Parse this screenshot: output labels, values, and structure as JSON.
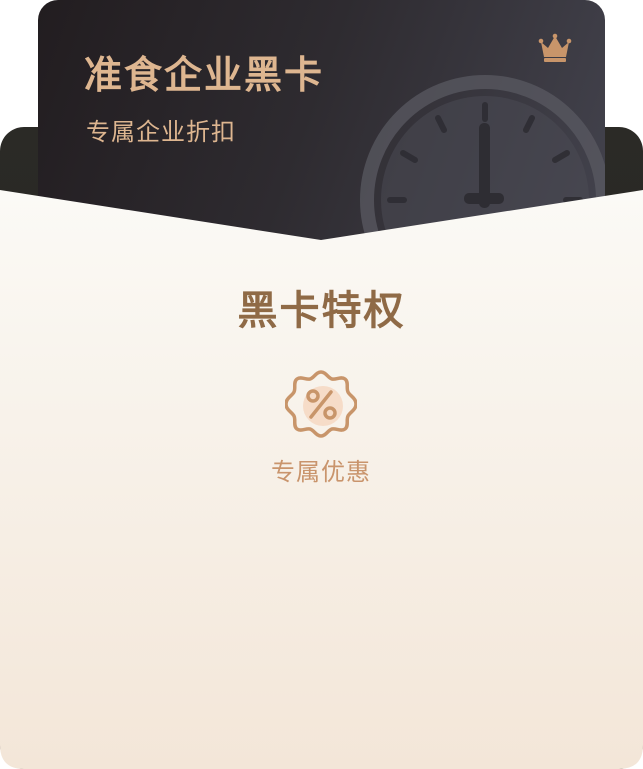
{
  "card": {
    "title": "准食企业黑卡",
    "subtitle": "专属企业折扣",
    "crown_icon": "crown-icon",
    "watermark_icon": "clock-icon"
  },
  "privileges": {
    "title": "黑卡特权",
    "items": [
      {
        "label": "专属优惠",
        "icon": "discount-badge-icon"
      }
    ]
  },
  "colors": {
    "gold": "#deb690",
    "title_brown": "#8f6a46",
    "label_gold": "#c9946c",
    "card_dark": "#221d20",
    "pocket_top": "#fbfaf6",
    "pocket_bottom": "#f3e6d8"
  }
}
